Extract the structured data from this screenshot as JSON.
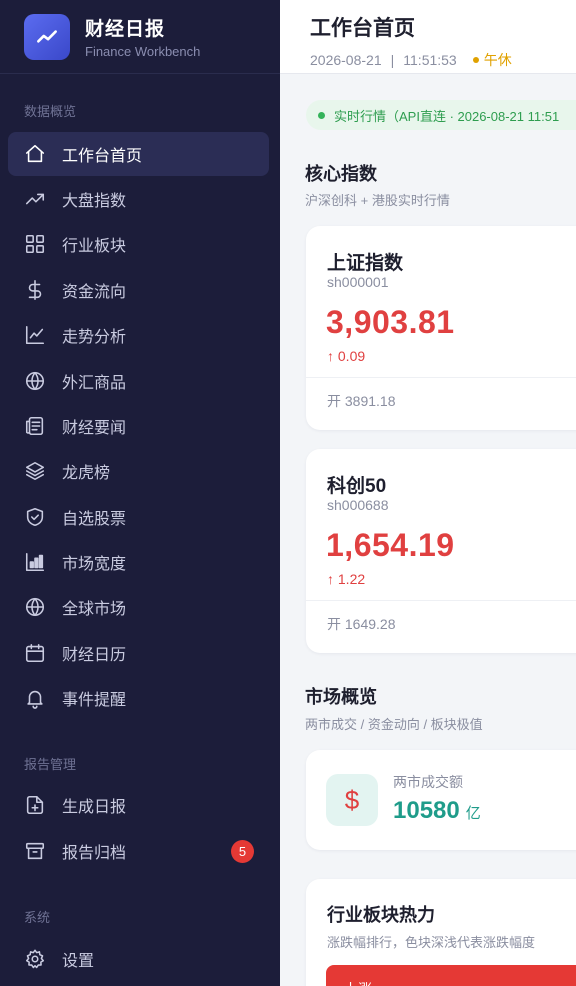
{
  "brand": {
    "title": "财经日报",
    "subtitle": "Finance Workbench"
  },
  "sidebar": {
    "sections": [
      {
        "label": "数据概览"
      },
      {
        "label": "报告管理"
      },
      {
        "label": "系统"
      }
    ],
    "items": [
      {
        "label": "工作台首页",
        "icon": "home-icon",
        "active": true
      },
      {
        "label": "大盘指数",
        "icon": "trending-up-icon"
      },
      {
        "label": "行业板块",
        "icon": "grid-icon"
      },
      {
        "label": "资金流向",
        "icon": "dollar-icon"
      },
      {
        "label": "走势分析",
        "icon": "line-chart-icon"
      },
      {
        "label": "外汇商品",
        "icon": "globe-icon"
      },
      {
        "label": "财经要闻",
        "icon": "newspaper-icon"
      },
      {
        "label": "龙虎榜",
        "icon": "layers-icon"
      },
      {
        "label": "自选股票",
        "icon": "shield-check-icon"
      },
      {
        "label": "市场宽度",
        "icon": "bar-chart-icon"
      },
      {
        "label": "全球市场",
        "icon": "globe-icon"
      },
      {
        "label": "财经日历",
        "icon": "calendar-icon"
      },
      {
        "label": "事件提醒",
        "icon": "bell-icon"
      },
      {
        "label": "生成日报",
        "icon": "file-plus-icon"
      },
      {
        "label": "报告归档",
        "icon": "archive-icon",
        "badge": "5"
      },
      {
        "label": "设置",
        "icon": "gear-icon"
      }
    ]
  },
  "header": {
    "title": "工作台首页",
    "date": "2026-08-21",
    "separator": "|",
    "time": "11:51:53",
    "status": "午休",
    "status_color": "#e0a100"
  },
  "live": {
    "text": "实时行情（API直连 · 2026-08-21 11:51"
  },
  "core": {
    "title": "核心指数",
    "subtitle": "沪深创科 + 港股实时行情",
    "cards": [
      {
        "name": "上证指数",
        "code": "sh000001",
        "value": "3,903.81",
        "change": "↑ 0.09",
        "open": "开 3891.18"
      },
      {
        "name": "科创50",
        "code": "sh000688",
        "value": "1,654.19",
        "change": "↑ 1.22",
        "open": "开 1649.28"
      }
    ]
  },
  "overview": {
    "title": "市场概览",
    "subtitle": "两市成交 / 资金动向 / 板块极值",
    "volume_label": "两市成交额",
    "volume_value": "10580",
    "volume_unit": "亿",
    "volume_icon": "$"
  },
  "heat": {
    "title": "行业板块热力",
    "subtitle": "涨跌幅排行，色块深浅代表涨跌幅度",
    "first_label": "上涨"
  },
  "colors": {
    "up": "#e04040",
    "accent": "#1f9c8a",
    "sidebar_bg": "#1c1d3a",
    "badge": "#e53935"
  }
}
